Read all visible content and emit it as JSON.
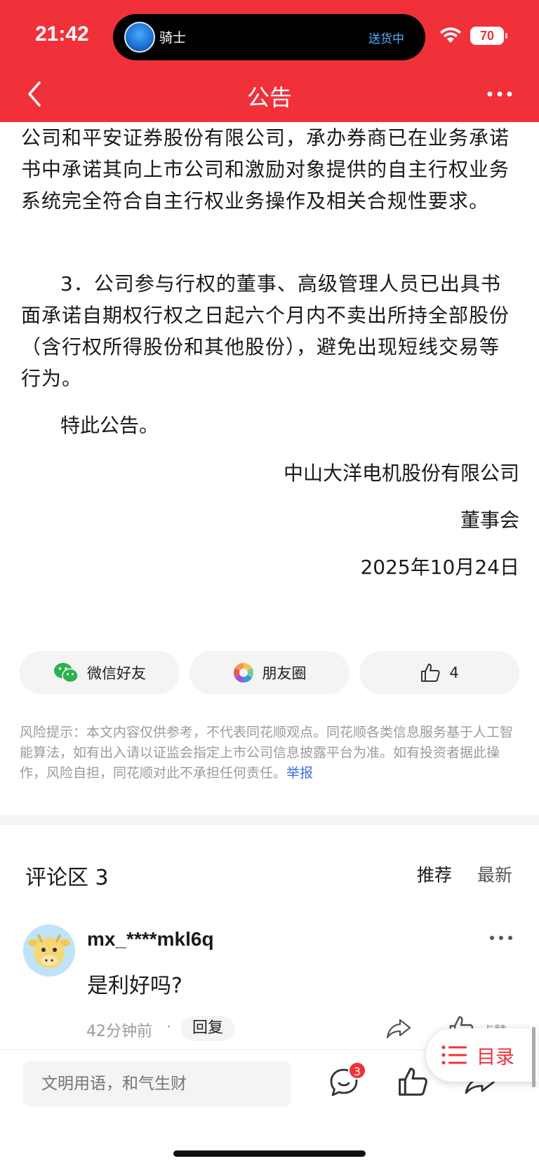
{
  "status_bar": {
    "time": "21:42",
    "island_label": "骑士",
    "island_status": "送货中",
    "battery": "70"
  },
  "nav": {
    "title": "公告"
  },
  "article": {
    "p1": "公司和平安证券股份有限公司，承办券商已在业务承诺书中承诺其向上市公司和激励对象提供的自主行权业务系统完全符合自主行权业务操作及相关合规性要求。",
    "p2": "3．公司参与行权的董事、高级管理人员已出具书面承诺自期权行权之日起六个月内不卖出所持全部股份（含行权所得股份和其他股份），避免出现短线交易等行为。",
    "p3": "特此公告。",
    "sign_company": "中山大洋电机股份有限公司",
    "sign_board": "董事会",
    "sign_date": "2025年10月24日"
  },
  "share": {
    "wechat_friend": "微信好友",
    "moments": "朋友圈",
    "like_count": "4"
  },
  "risk": {
    "text": "风险提示：本文内容仅供参考，不代表同花顺观点。同花顺各类信息服务基于人工智能算法，如有出入请以证监会指定上市公司信息披露平台为准。如有投资者据此操作，风险自担，同花顺对此不承担任何责任。",
    "report": "举报"
  },
  "comments": {
    "title": "评论区 3",
    "sort_recommend": "推荐",
    "sort_latest": "最新",
    "items": [
      {
        "user": "mx_****mkl6q",
        "text": "是利好吗?",
        "time": "42分钟前",
        "dot": "·",
        "reply": "回复",
        "like_text": "点赞"
      }
    ]
  },
  "bottom": {
    "input_placeholder": "文明用语，和气生财",
    "comment_badge": "3"
  },
  "toc": {
    "label": "目录"
  },
  "colors": {
    "brand_red": "#f1313a",
    "link_blue": "#3b6fd8"
  }
}
